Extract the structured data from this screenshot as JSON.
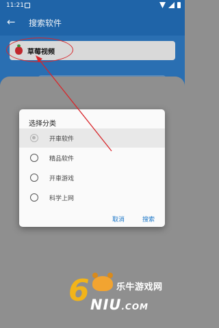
{
  "status_bar": {
    "time": "11:21"
  },
  "app_bar": {
    "title": "搜索软件",
    "back_icon": "arrow-left-icon"
  },
  "search": {
    "value": "草莓视频",
    "logo_icon": "strawberry-icon"
  },
  "dialog": {
    "title": "选择分类",
    "options": [
      {
        "label": "开車软件",
        "selected": true
      },
      {
        "label": "精品软件",
        "selected": false
      },
      {
        "label": "开車游戏",
        "selected": false
      },
      {
        "label": "科学上网",
        "selected": false
      }
    ],
    "cancel_label": "取消",
    "search_label": "搜索"
  },
  "annotation": {
    "color": "#d8262b"
  },
  "watermark": {
    "cn_text": "乐牛游戏网",
    "six": "6",
    "en_text": "NIU",
    "com": ".COM"
  },
  "colors": {
    "primary": "#1f64a8",
    "accent": "#1e78c8",
    "scrim": "#8f8f8f"
  }
}
